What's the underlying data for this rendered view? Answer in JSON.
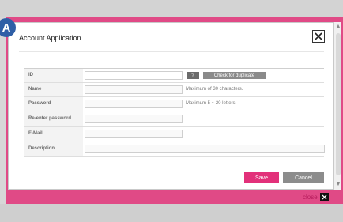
{
  "badge": {
    "label": "A"
  },
  "dialog": {
    "title": "Account Application",
    "close_icon": "close-x-icon"
  },
  "form": {
    "rows": [
      {
        "label": "ID"
      },
      {
        "label": "Name",
        "hint": "Maximum of 30 characters."
      },
      {
        "label": "Password",
        "hint": "Maximum 5 ~ 20 letters"
      },
      {
        "label": "Re-enter password"
      },
      {
        "label": "E-Mail"
      },
      {
        "label": "Description"
      }
    ],
    "help_button": "?",
    "check_button": "Check for duplicate"
  },
  "actions": {
    "save": "Save",
    "cancel": "Cancel"
  },
  "footer": {
    "close_label": "close"
  },
  "colors": {
    "accent": "#e2317a",
    "frame": "#e04a86",
    "neutral_button": "#8c8c8c",
    "badge": "#2f5fa6"
  }
}
